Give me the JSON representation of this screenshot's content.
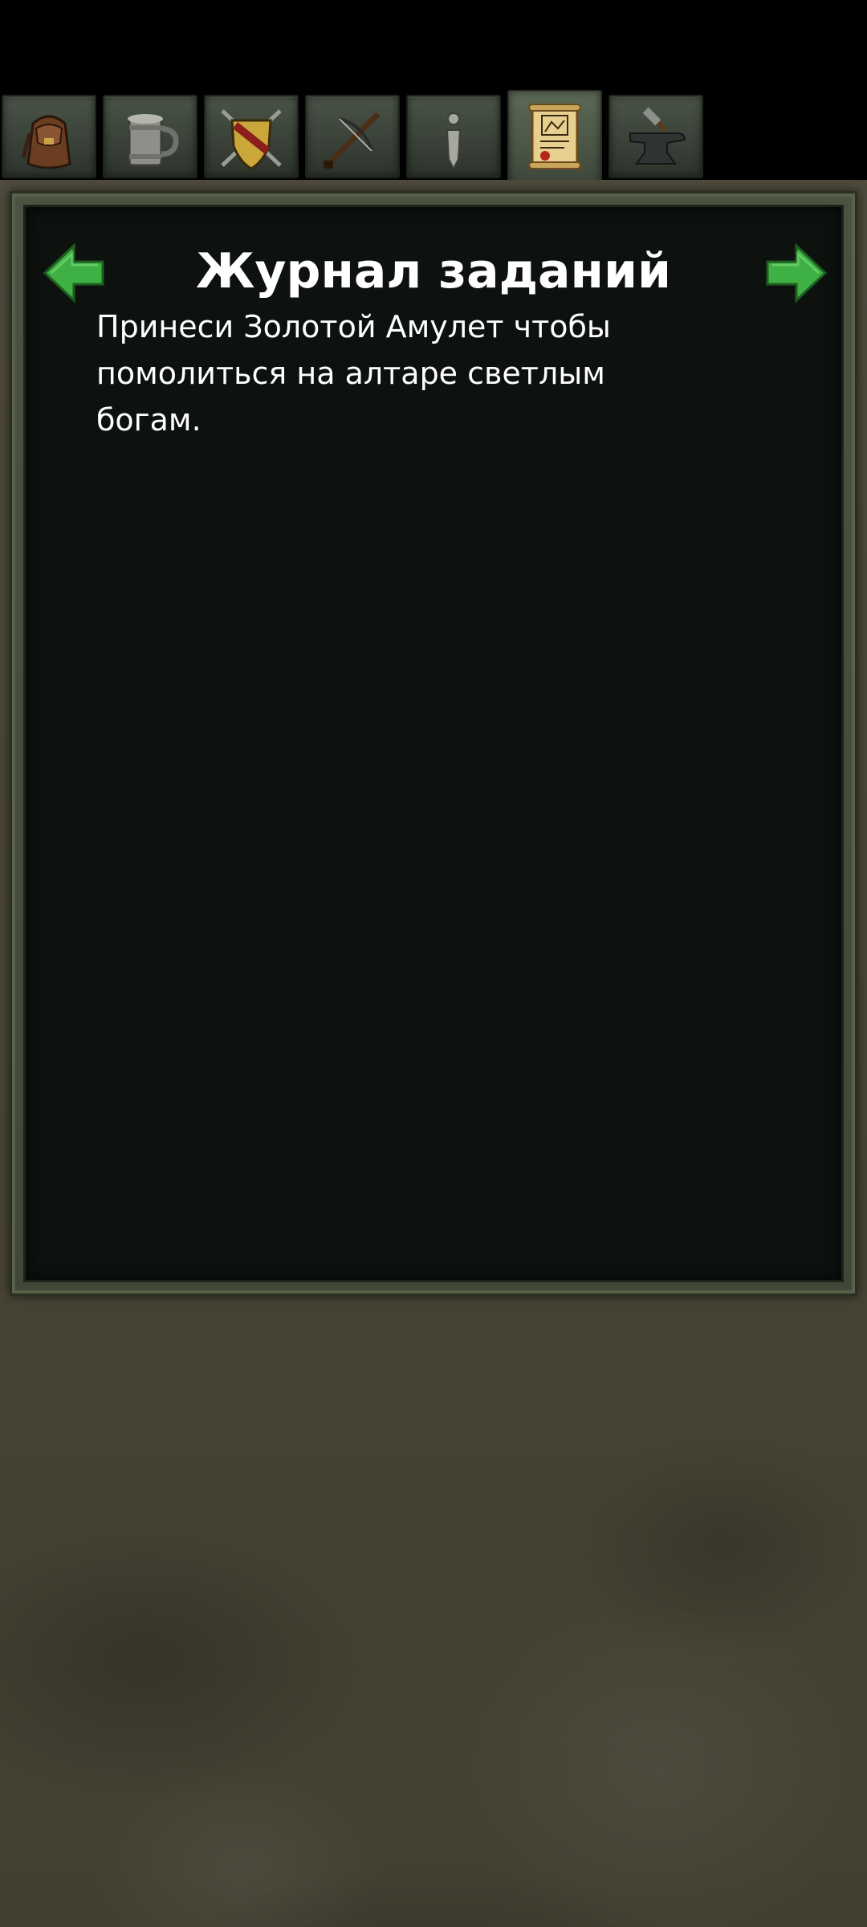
{
  "tabs": [
    {
      "icon": "backpack-icon",
      "active": false
    },
    {
      "icon": "tankard-icon",
      "active": false
    },
    {
      "icon": "shield-swords-icon",
      "active": false
    },
    {
      "icon": "crossbow-icon",
      "active": false
    },
    {
      "icon": "info-icon",
      "active": false
    },
    {
      "icon": "quest-scroll-icon",
      "active": true
    },
    {
      "icon": "anvil-icon",
      "active": false
    }
  ],
  "close_icon": "red-x-icon",
  "quest_log": {
    "title": "Журнал заданий",
    "text": "Принеси Золотой Амулет чтобы помолиться на алтаре светлым богам.",
    "prev_icon": "green-arrow-left-icon",
    "next_icon": "green-arrow-right-icon"
  },
  "colors": {
    "panel_bg": "#0d120e",
    "frame": "#4a5240",
    "stone": "#4a4636",
    "arrow_green": "#3fb043",
    "close_red": "#d62a22"
  }
}
